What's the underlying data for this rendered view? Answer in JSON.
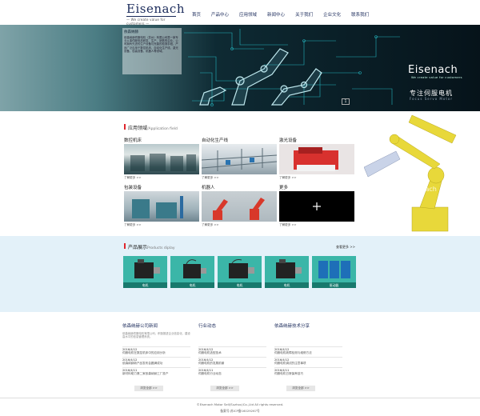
{
  "header": {
    "logo": "Eisenach",
    "tagline": "— We create value for customers —",
    "nav": [
      "首页",
      "产品中心",
      "应用领域",
      "新闻中心",
      "关于我们",
      "企业文化",
      "联系我们"
    ]
  },
  "banner": {
    "intro_title": "依森纳赫",
    "intro_text": "依森纳赫伺服电机（苏州）有限公司是一家专业从事伺服电机研发、生产、销售的企业，公司拥有先进的生产设备与完善的检测手段，产品广泛应用于数控机床、自动化生产线、激光设备、包装设备、机器人等领域。",
    "brand": "Eisenach",
    "brand_tag": "We create value for customers",
    "slogan": "专注伺服电机",
    "slogan_en": "Focus Servo Motor",
    "pager": "1"
  },
  "applications": {
    "title": "应用领域",
    "subtitle": "/Application field",
    "more_label": "了解更多 >>",
    "items": [
      {
        "label": "数控机床"
      },
      {
        "label": "自动化生产线"
      },
      {
        "label": "激光设备"
      },
      {
        "label": "包装设备"
      },
      {
        "label": "机器人"
      },
      {
        "label": "更多"
      }
    ]
  },
  "products": {
    "title": "产品展示",
    "subtitle": "Products diplay",
    "more": "查看更多 >>",
    "items": [
      {
        "caption": "电机"
      },
      {
        "caption": "电机"
      },
      {
        "caption": "电机"
      },
      {
        "caption": "电机"
      },
      {
        "caption": "驱动器"
      }
    ]
  },
  "news": {
    "button": "浏览全部 >>",
    "columns": [
      {
        "title": "依森纳赫公司新闻",
        "intro": "依森纳赫伺服电机有限公司，积极推进企业信息化，建设高水平的信息管理系统。",
        "items": [
          {
            "date": "2016/4/12",
            "title": "伺服电机在数控机床中的应用分析"
          },
          {
            "date": "2016/4/12",
            "title": "依森纳赫新产品发布会圆满成功"
          },
          {
            "date": "2016/4/11",
            "title": "新材料助力第二家依森纳赫工厂投产"
          }
        ]
      },
      {
        "title": "行业动态",
        "intro": "",
        "items": [
          {
            "date": "2016/4/12",
            "title": "伺服电机选型技术"
          },
          {
            "date": "2016/4/12",
            "title": "伺服电机的发展前景"
          },
          {
            "date": "2016/4/11",
            "title": "伺服电机行业动态"
          }
        ]
      },
      {
        "title": "依森纳赫技术分享",
        "intro": "",
        "items": [
          {
            "date": "2016/4/12",
            "title": "伺服电机故障检测与维修方法"
          },
          {
            "date": "2016/4/12",
            "title": "伺服电机调试的注意事项"
          },
          {
            "date": "2016/4/11",
            "title": "伺服电机日常保养技巧"
          }
        ]
      }
    ]
  },
  "footer": {
    "copyright": "©Eisenach Motor Sell(Suzhou)Co.,Ltd All rights reserved.",
    "icp": "备案号:苏ICP备16029267号"
  },
  "colors": {
    "accent": "#e0262d",
    "navy": "#1a2a5a",
    "product_bg": "#e3f1f9",
    "product_tile": "#3bb6a8"
  }
}
